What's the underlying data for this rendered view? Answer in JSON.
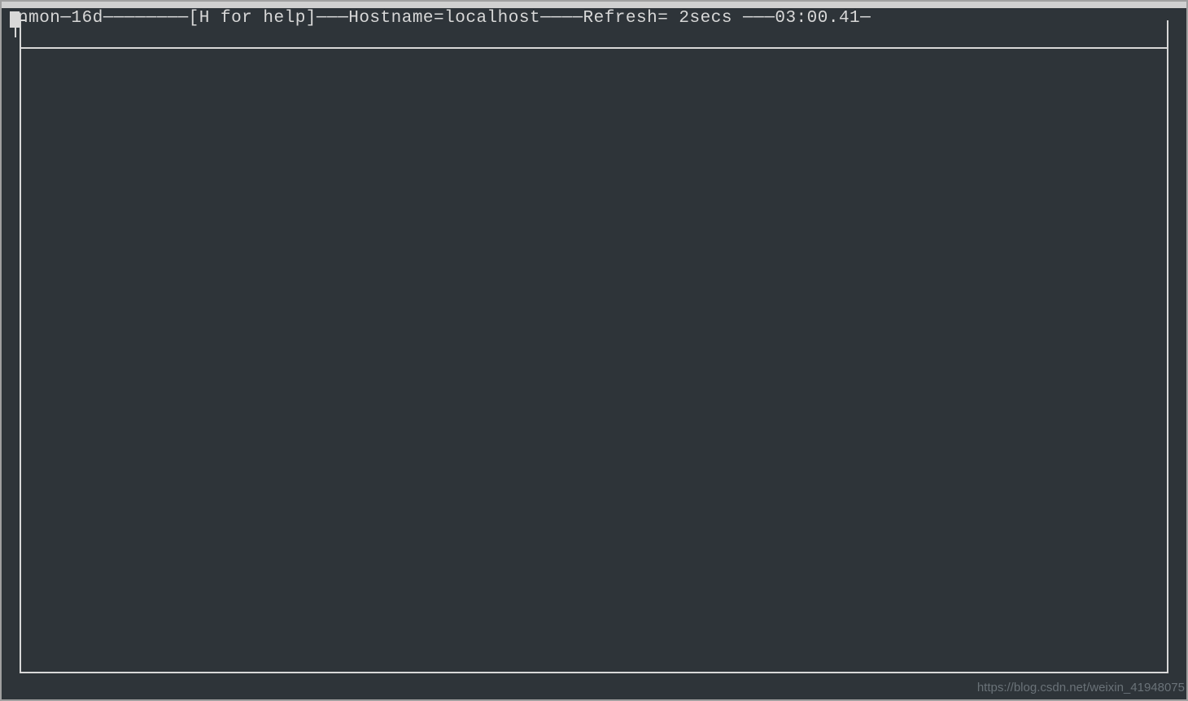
{
  "header": {
    "app_name": "nmon",
    "version": "16d",
    "help_hint": "[H for help]",
    "hostname_label": "Hostname=",
    "hostname_value": "localhost",
    "refresh_label": "Refresh= ",
    "refresh_value": "2secs",
    "timestamp": "03:00.41"
  },
  "watermark": "https://blog.csdn.net/weixin_41948075"
}
